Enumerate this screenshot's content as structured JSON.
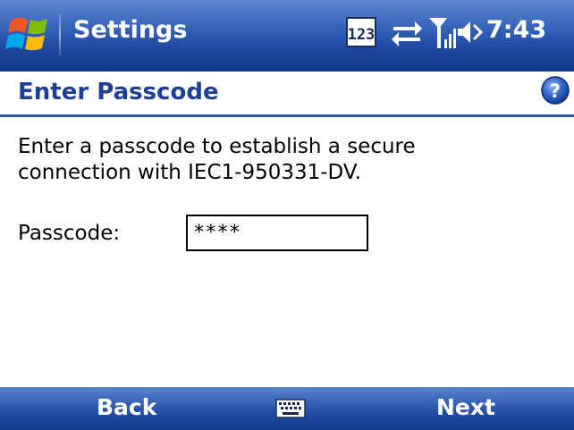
{
  "titlebar": {
    "title": "Settings",
    "clock": "7:43",
    "icons": [
      "windows-start-icon",
      "input-123-icon",
      "sync-arrows-icon",
      "signal-strength-icon",
      "speaker-icon"
    ]
  },
  "page": {
    "title": "Enter Passcode",
    "help_icon": "help-icon",
    "instructions": "Enter a passcode to establish a secure connection with IEC1-950331-DV.",
    "passcode_label": "Passcode:",
    "passcode_value": "****"
  },
  "menubar": {
    "left_softkey": "Back",
    "right_softkey": "Next",
    "center_icon": "keyboard-icon"
  },
  "colors": {
    "bar_top": "#5d86cf",
    "bar_bottom": "#123a8a",
    "header_text": "#1c3f9a",
    "rule": "#2b53a6"
  }
}
